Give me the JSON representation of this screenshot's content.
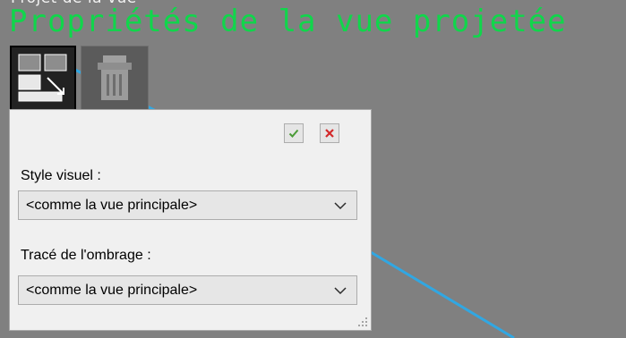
{
  "canvas": {
    "top_cut_text": "Projet de la vue",
    "view_title": "Propriétés de la vue projetée",
    "title_color": "#10d64b",
    "background_color": "#808080",
    "line_color": "#31a7e2"
  },
  "toolbar": {
    "properties_icon": "view-properties-icon",
    "delete_icon": "trash-can-icon"
  },
  "panel": {
    "ok_icon": "check-icon",
    "cancel_icon": "close-icon",
    "visual_style": {
      "label": "Style visuel :",
      "value": "<comme la vue principale>"
    },
    "shade_plot": {
      "label": "Tracé de l'ombrage :",
      "value": "<comme la vue principale>"
    },
    "resize_icon": "resize-grip-icon"
  }
}
